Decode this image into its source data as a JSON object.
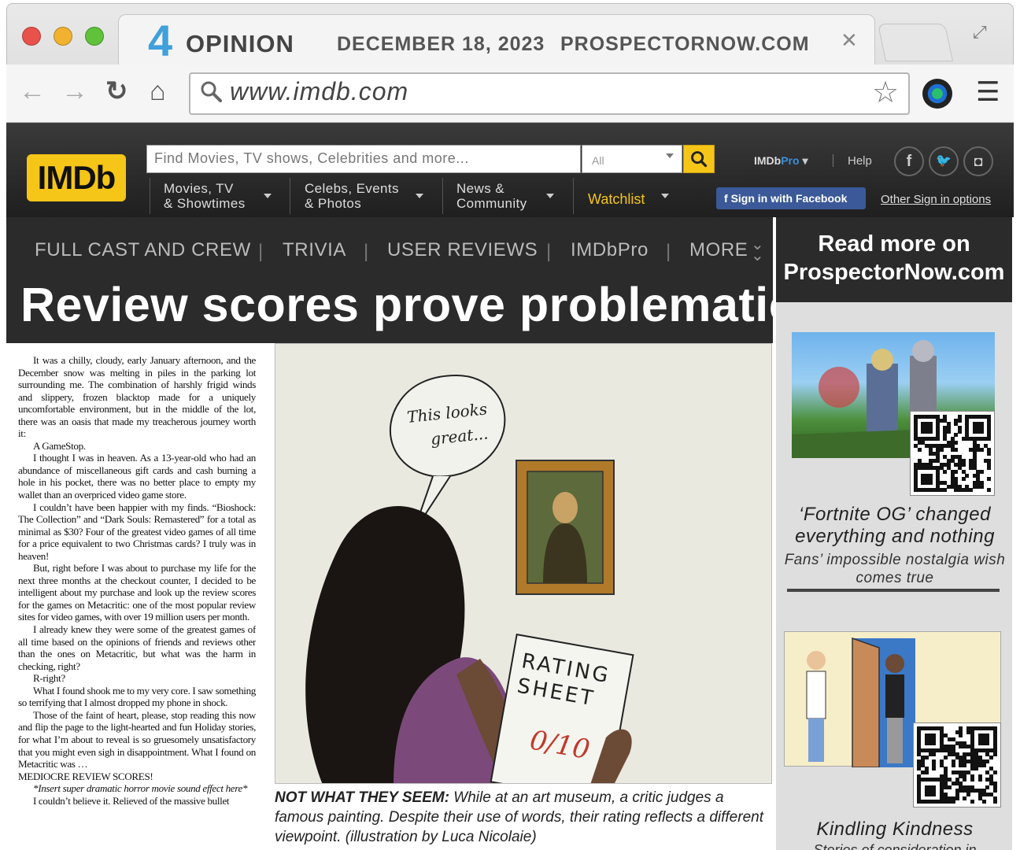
{
  "browser": {
    "tab_number": "4",
    "tab_section": "OPINION",
    "tab_date": "DECEMBER 18, 2023",
    "tab_site": "PROSPECTORNOW.COM",
    "url": "www.imdb.com"
  },
  "imdb": {
    "logo": "IMDb",
    "search_placeholder": "Find Movies, TV shows, Celebrities and more...",
    "search_category": "All",
    "nav": [
      {
        "line1": "Movies, TV",
        "line2": "& Showtimes"
      },
      {
        "line1": "Celebs, Events",
        "line2": "& Photos"
      },
      {
        "line1": "News &",
        "line2": "Community"
      }
    ],
    "watchlist": "Watchlist",
    "pro_a": "IMDb",
    "pro_b": "Pro",
    "help": "Help",
    "facebook_signin": "Sign in with Facebook",
    "other_signin": "Other Sign in options"
  },
  "subnav": [
    "FULL CAST AND CREW",
    "TRIVIA",
    "USER REVIEWS",
    "IMDbPro",
    "MORE"
  ],
  "headline": "Review scores prove problematic",
  "sidebar": {
    "header_line1": "Read more on",
    "header_line2": "ProspectorNow.com",
    "story1_title": "‘Fortnite OG’ changed everything and nothing",
    "story1_sub": "Fans’ impossible nostalgia wish comes true",
    "story2_title": "Kindling Kindness",
    "story2_sub": "Stories of consideration in"
  },
  "illustration": {
    "speech_line1": "This looks",
    "speech_line2": "great...",
    "sheet_line1": "RATING",
    "sheet_line2": "SHEET",
    "score": "0/10"
  },
  "caption": {
    "lead": "NOT WHAT THEY SEEM:",
    "text": " While at an art museum, a critic judges a famous painting. Despite their use of words, their rating reflects a different viewpoint. (illustration by Luca Nicolaie)"
  },
  "article": [
    "It was a chilly, cloudy, early January afternoon, and the December snow was melting in piles in the parking lot surrounding me. The combination of harshly frigid winds and slippery, frozen blacktop made for a uniquely uncomfortable environment, but in the middle of the lot, there was an oasis that made my treacherous journey worth it:",
    "A GameStop.",
    "I thought I was in heaven. As a 13-year-old who had an abundance of miscellaneous gift cards and cash burning a hole in his pocket, there was no better place to empty my wallet than an overpriced video game store.",
    "I couldn’t have been happier with my finds. “Bioshock: The Collection” and “Dark Souls: Remastered” for a total as minimal as $30? Four of the greatest video games of all time for a price equivalent to two Christmas cards? I truly was in heaven!",
    "But, right before I was about to purchase my life for the next three months at the checkout counter, I decided to be intelligent about my purchase and look up the review scores for the games on Metacritic: one of the most popular review sites for video games, with over 19 million users per month.",
    "I already knew they were some of the greatest games of all time based on the opinions of friends and reviews other than the ones on Metacritic, but what was the harm in checking, right?",
    "R-right?",
    "What I found shook me to my very core. I saw something so terrifying that I almost dropped my phone in shock.",
    "Those of the faint of heart, please, stop reading this now and flip the page to the light-hearted and fun Holiday stories, for what I’m about to reveal is so gruesomely unsatisfactory that you might even sigh in disappointment. What I found on Metacritic was …",
    "MEDIOCRE REVIEW SCORES!",
    "*Insert super dramatic horror movie sound effect here*",
    "I couldn’t believe it. Relieved of the massive bullet"
  ]
}
